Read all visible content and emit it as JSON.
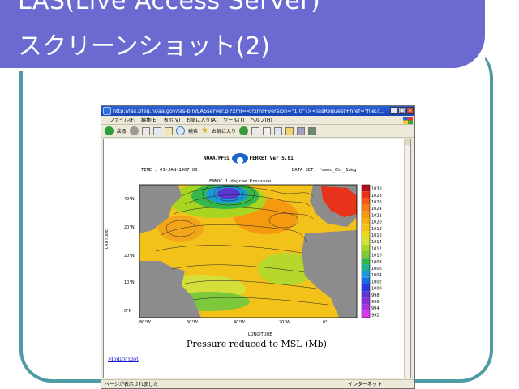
{
  "slide": {
    "title_line1": "LAS(Live Access Server)",
    "title_line2": "スクリーンショット(2)"
  },
  "browser": {
    "window_title": "http://las.pfeg.noaa.gov/las-bin/LASserver.pl?xml=<?xml+version=\"1.0\"?><lasRequest+href=\"file:/...",
    "menu": [
      "ファイル(F)",
      "編集(E)",
      "表示(V)",
      "お気に入り(A)",
      "ツール(T)",
      "ヘルプ(H)"
    ],
    "toolbar": {
      "back_label": "戻る",
      "search_label": "検索",
      "favorites_label": "お気に入り"
    },
    "status_left": "ページが表示されました",
    "status_right": "インターネット"
  },
  "plot": {
    "brand_left": "NOAA/PFEL",
    "brand_right": "FERRET Ver 5.81",
    "time_text": "TIME : 01-JAN-1967 00",
    "dataset_text": "DATA SET: fnmoc_6hr_1deg",
    "subtitle": "FNMOC 1-degree Pressure",
    "x_axis_label": "LONGITUDE",
    "y_axis_label": "LATITUDE",
    "x_ticks": [
      "80°W",
      "60°W",
      "40°W",
      "20°W",
      "0°"
    ],
    "y_ticks": [
      "40°N",
      "20°N",
      "20°N",
      "10°N",
      "0°N"
    ],
    "colorbar_ticks": [
      "1030",
      "1028",
      "1026",
      "1024",
      "1022",
      "1020",
      "1018",
      "1016",
      "1014",
      "1012",
      "1010",
      "1008",
      "1006",
      "1004",
      "1002",
      "1000",
      "998",
      "996",
      "994",
      "992"
    ],
    "caption": "Pressure reduced to MSL (Mb)",
    "modify_link": "Modify plot"
  },
  "colors": {
    "slide_header": "#6a6ad0",
    "slide_arc": "#4f9aa3",
    "titlebar": "#1f4fc0",
    "land": "#8c8c8c"
  }
}
